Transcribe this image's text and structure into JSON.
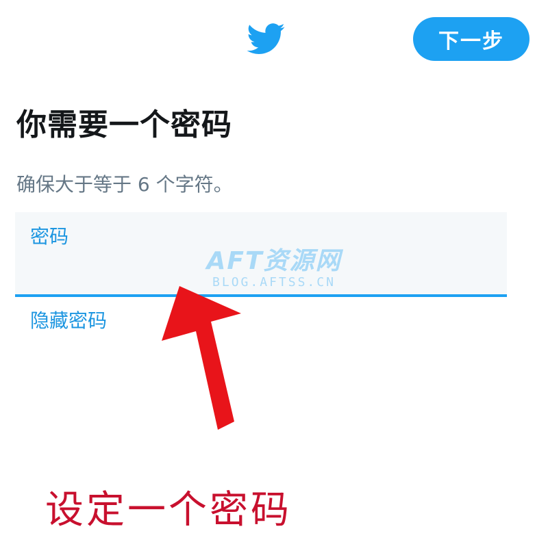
{
  "app": {
    "logo_icon": "twitter-bird-icon",
    "brand_color": "#1da1f2"
  },
  "header": {
    "next_label": "下一步"
  },
  "content": {
    "title": "你需要一个密码",
    "subtitle": "确保大于等于 6 个字符。",
    "password_label": "密码",
    "password_value": "",
    "hide_password_label": "隐藏密码"
  },
  "watermark": {
    "main": "AFT资源网",
    "sub": "BLOG.AFTSS.CN"
  },
  "annotation": {
    "text": "设定一个密码",
    "arrow_color": "#e8141a"
  }
}
